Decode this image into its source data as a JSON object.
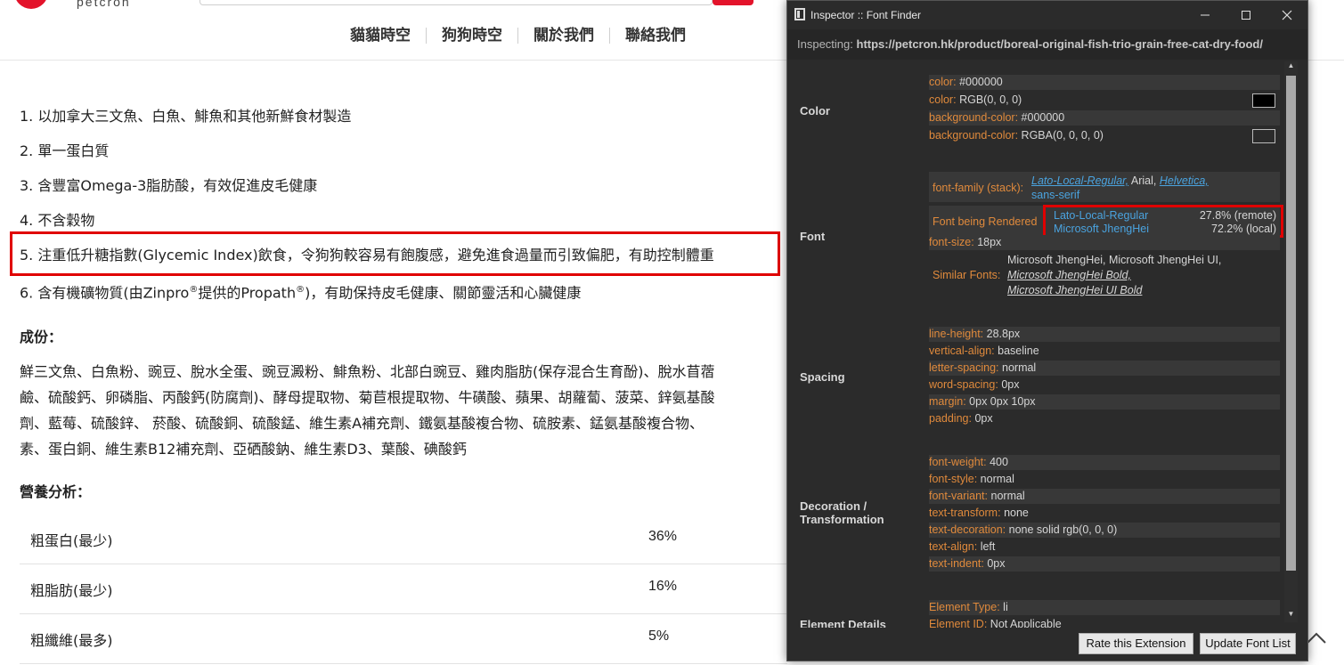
{
  "site": {
    "logo_text": "petcron",
    "nav": [
      "貓貓時空",
      "狗狗時空",
      "關於我們",
      "聯絡我們"
    ],
    "features": [
      "1. 以加拿大三文魚、白魚、鯡魚和其他新鮮食材製造",
      "2. 單一蛋白質",
      "3. 含豐富Omega-3脂肪酸，有效促進皮毛健康",
      "4. 不含穀物",
      "5. 注重低升糖指數(Glycemic Index)飲食，令狗狗較容易有飽腹感，避免進食過量而引致偏肥，有助控制體重"
    ],
    "feature6": {
      "part1": "6. 含有機礦物質(由Zinpro",
      "sup1": "®",
      "part2": "提供的Propath",
      "sup2": "®",
      "part3": ")，有助保持皮毛健康、關節靈活和心臟健康"
    },
    "ingredients_title": "成份：",
    "ingredients_lines": [
      "鮮三文魚、白魚粉、豌豆、脫水全蛋、豌豆澱粉、鯡魚粉、北部白豌豆、雞肉脂肪(保存混合生育酚)、脫水苜蓿",
      "鹼、硫酸鈣、卵磷脂、丙酸鈣(防腐劑)、酵母提取物、菊苣根提取物、牛磺酸、蘋果、胡蘿蔔、菠菜、鋅氨基酸",
      "劑、藍莓、硫酸鋅、 菸酸、硫酸銅、硫酸錳、維生素A補充劑、鐵氨基酸複合物、硫胺素、錳氨基酸複合物、",
      "素、蛋白銅、維生素B12補充劑、亞硒酸鈉、維生素D3、葉酸、碘酸鈣"
    ],
    "nutrition_title": "營養分析：",
    "nutrition": [
      {
        "name": "粗蛋白(最少)",
        "value": "36%"
      },
      {
        "name": "粗脂肪(最少)",
        "value": "16%"
      },
      {
        "name": "粗纖維(最多)",
        "value": "5%"
      }
    ]
  },
  "inspector": {
    "window_title": "Inspector :: Font Finder",
    "inspecting_label": "Inspecting:",
    "inspecting_url": "https://petcron.hk/product/boreal-original-fish-trio-grain-free-cat-dry-food/",
    "sections": {
      "color": "Color",
      "font": "Font",
      "spacing": "Spacing",
      "decoration": [
        "Decoration /",
        "Transformation"
      ],
      "element": "Element Details"
    },
    "color_rows": [
      {
        "name": "color:",
        "value": "#000000"
      },
      {
        "name": "color:",
        "value": "RGB(0, 0, 0)"
      },
      {
        "name": "background-color:",
        "value": "#000000"
      },
      {
        "name": "background-color:",
        "value": "RGBA(0, 0, 0, 0)"
      }
    ],
    "swatch_colors": [
      "#000000",
      "#2b2b2b"
    ],
    "font_family_label": "font-family (stack):",
    "font_stack": [
      "Lato-Local-Regular,",
      "Arial,",
      "Helvetica,",
      "sans-serif"
    ],
    "font_rendered_label": "Font being Rendered",
    "rendered_fonts": [
      {
        "name": "Lato-Local-Regular",
        "pct": "27.8% (remote)"
      },
      {
        "name": "Microsoft JhengHei",
        "pct": "72.2% (local)"
      }
    ],
    "font_size_label": "font-size:",
    "font_size": "18px",
    "similar_label": "Similar Fonts:",
    "similar_fonts": [
      "Microsoft JhengHei,",
      "Microsoft JhengHei UI,",
      "Microsoft JhengHei Bold,",
      "Microsoft JhengHei UI Bold"
    ],
    "spacing_rows": [
      {
        "name": "line-height:",
        "value": "28.8px"
      },
      {
        "name": "vertical-align:",
        "value": "baseline"
      },
      {
        "name": "letter-spacing:",
        "value": "normal"
      },
      {
        "name": "word-spacing:",
        "value": "0px"
      },
      {
        "name": "margin:",
        "value": "0px 0px 10px"
      },
      {
        "name": "padding:",
        "value": "0px"
      }
    ],
    "decoration_rows": [
      {
        "name": "font-weight:",
        "value": "400"
      },
      {
        "name": "font-style:",
        "value": "normal"
      },
      {
        "name": "font-variant:",
        "value": "normal"
      },
      {
        "name": "text-transform:",
        "value": "none"
      },
      {
        "name": "text-decoration:",
        "value": "none solid rgb(0, 0, 0)"
      },
      {
        "name": "text-align:",
        "value": "left"
      },
      {
        "name": "text-indent:",
        "value": "0px"
      }
    ],
    "element_rows": [
      {
        "name": "Element Type:",
        "value": "li"
      },
      {
        "name": "Element ID:",
        "value": "Not Applicable"
      }
    ],
    "buttons": {
      "rate": "Rate this Extension",
      "update": "Update Font List"
    }
  },
  "accent_colors": {
    "brand_red": "#e3132b",
    "highlight_red": "#e00000",
    "prop_orange": "#e08a3c",
    "link_blue": "#4aa3df"
  }
}
